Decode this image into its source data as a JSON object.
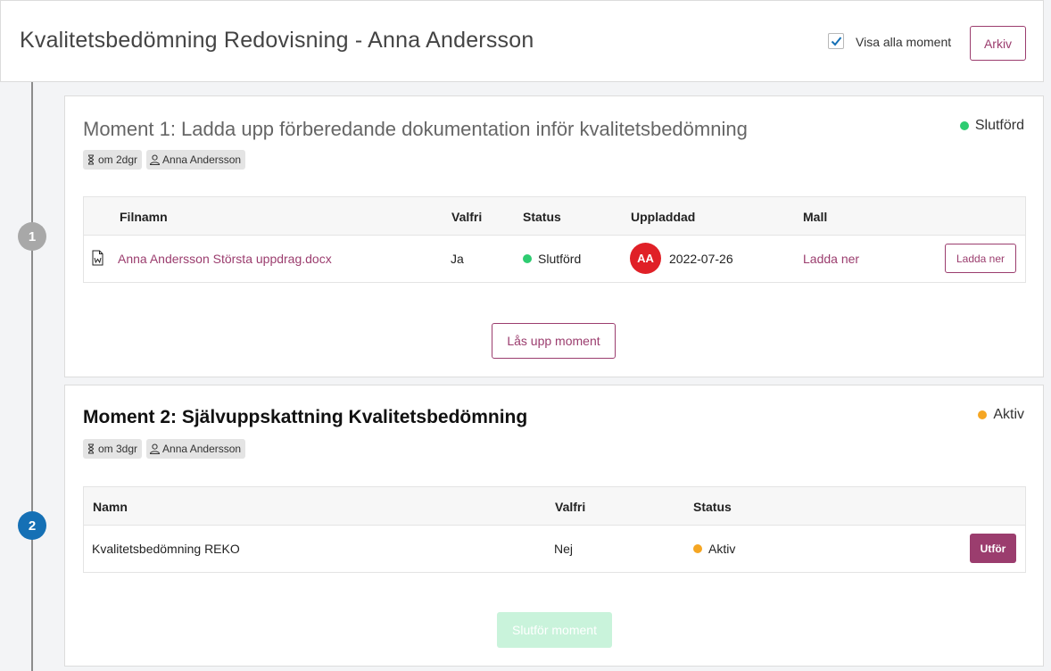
{
  "header": {
    "title": "Kvalitetsbedömning Redovisning - Anna Andersson",
    "show_all_label": "Visa alla moment",
    "show_all_checked": true,
    "archive_button": "Arkiv"
  },
  "steps": [
    "1",
    "2"
  ],
  "moment1": {
    "title": "Moment 1: Ladda upp förberedande dokumentation inför kvalitetsbedömning",
    "status": "Slutförd",
    "tags": {
      "due": "om 2dgr",
      "assignee": "Anna Andersson"
    },
    "columns": [
      "Filnamn",
      "Valfri",
      "Status",
      "Uppladdad",
      "Mall"
    ],
    "row": {
      "filename": "Anna Andersson Största uppdrag.docx",
      "optional": "Ja",
      "status": "Slutförd",
      "uploader_initials": "AA",
      "uploaded_date": "2022-07-26",
      "template_link": "Ladda ner",
      "download_button": "Ladda ner"
    },
    "unlock_button": "Lås upp moment"
  },
  "moment2": {
    "title": "Moment 2: Självuppskattning Kvalitetsbedömning",
    "status": "Aktiv",
    "tags": {
      "due": "om 3dgr",
      "assignee": "Anna Andersson"
    },
    "columns": [
      "Namn",
      "Valfri",
      "Status"
    ],
    "row": {
      "name": "Kvalitetsbedömning REKO",
      "optional": "Nej",
      "status": "Aktiv",
      "action_button": "Utför"
    },
    "complete_button": "Slutför moment"
  },
  "colors": {
    "accent": "#9b3d6e",
    "step_active": "#1570b5",
    "step_done": "#a8a8a8",
    "status_done": "#2ecc71",
    "status_active": "#f5a623",
    "avatar": "#e02027"
  }
}
